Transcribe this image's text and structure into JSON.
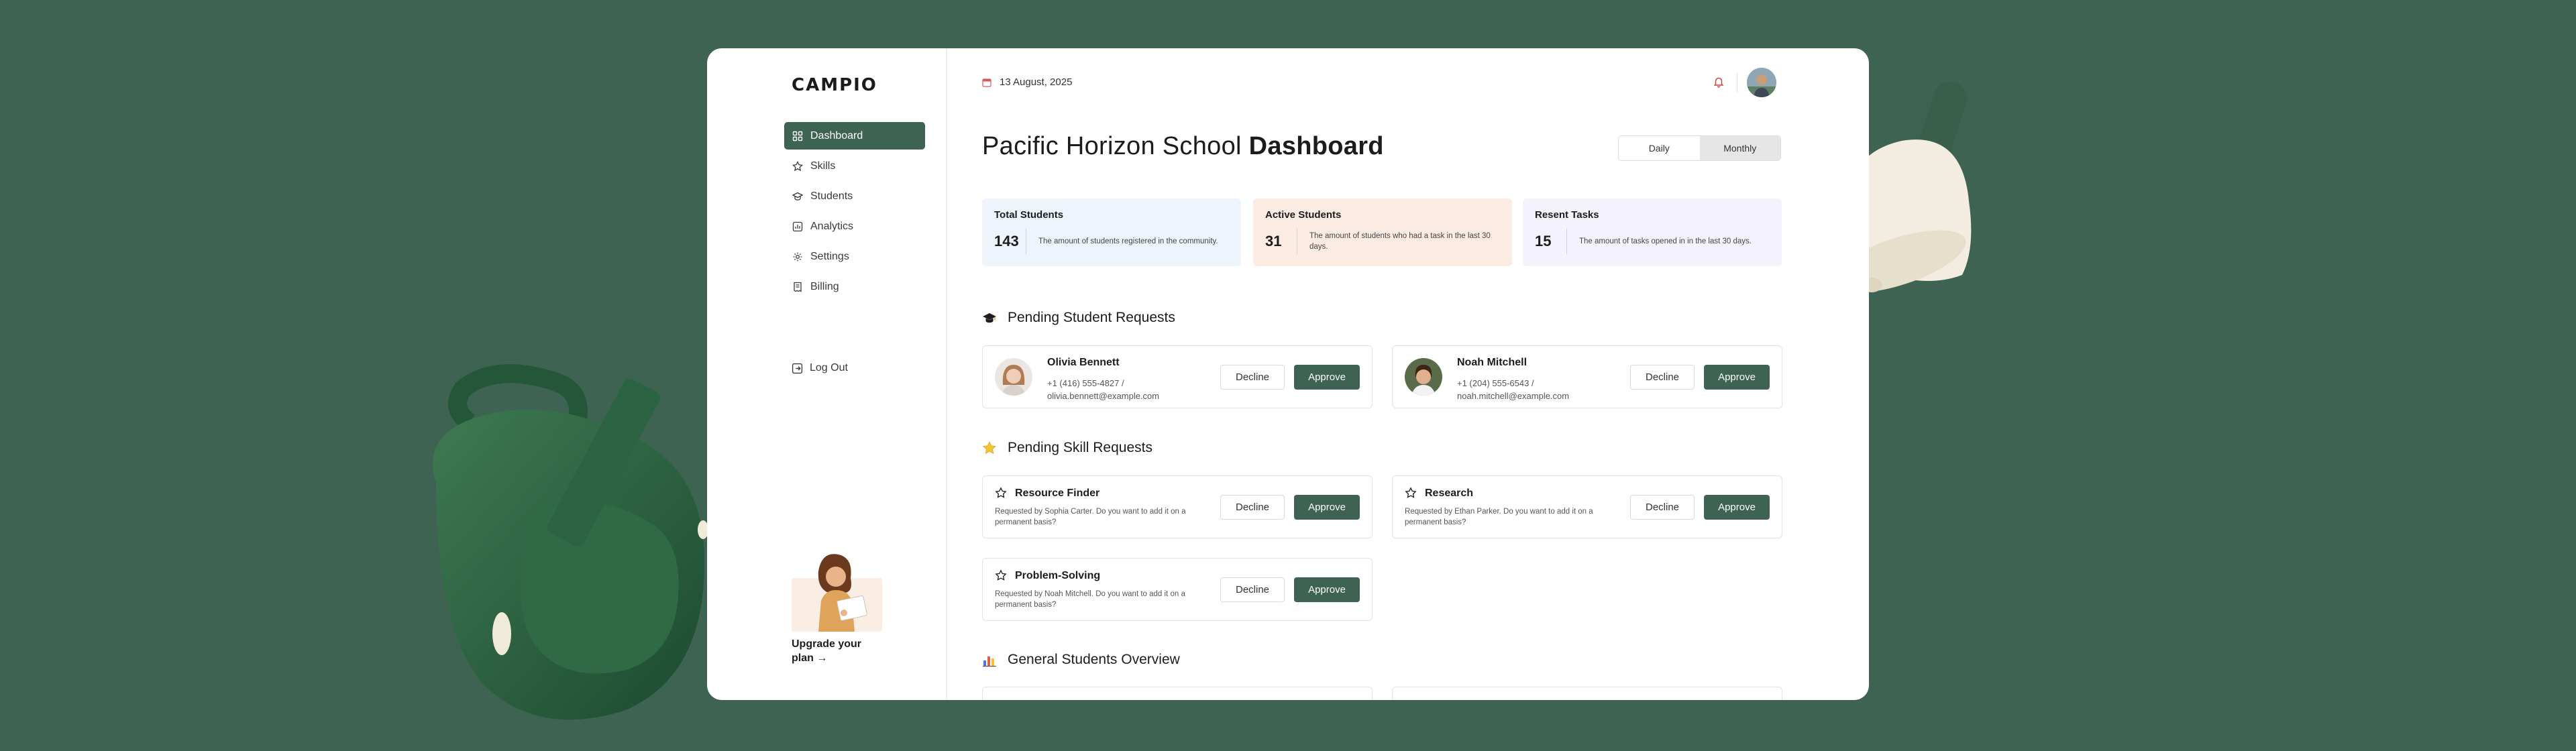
{
  "brand": {
    "logo": "CAMPIO"
  },
  "sidebar": {
    "items": [
      {
        "label": "Dashboard",
        "icon": "grid-icon",
        "active": true
      },
      {
        "label": "Skills",
        "icon": "star-icon",
        "active": false
      },
      {
        "label": "Students",
        "icon": "graduation-cap-icon",
        "active": false
      },
      {
        "label": "Analytics",
        "icon": "chart-icon",
        "active": false
      },
      {
        "label": "Settings",
        "icon": "gear-icon",
        "active": false
      },
      {
        "label": "Billing",
        "icon": "receipt-icon",
        "active": false
      }
    ],
    "logout_label": "Log Out",
    "upgrade_label": "Upgrade your plan",
    "upgrade_arrow": "→"
  },
  "header": {
    "date": "13 August, 2025"
  },
  "page": {
    "title_light": "Pacific Horizon School",
    "title_bold": "Dashboard"
  },
  "toggle": {
    "options": [
      "Daily",
      "Monthly"
    ],
    "selected": "Monthly"
  },
  "stats": [
    {
      "title": "Total Students",
      "value": "143",
      "desc": "The amount of students registered in the community.",
      "color": "#eef4fc"
    },
    {
      "title": "Active Students",
      "value": "31",
      "desc": "The amount of students who had a task in the last 30 days.",
      "color": "#fcebe3"
    },
    {
      "title": "Resent Tasks",
      "value": "15",
      "desc": "The amount of tasks opened in in the last 30 days.",
      "color": "#f4f2fc"
    }
  ],
  "student_requests": {
    "title": "Pending Student Requests",
    "items": [
      {
        "name": "Olivia Bennett",
        "phone": "+1 (416) 555-4827  /",
        "email": "olivia.bennett@example.com"
      },
      {
        "name": "Noah Mitchell",
        "phone": "+1 (204) 555-6543  /",
        "email": "noah.mitchell@example.com"
      }
    ]
  },
  "skill_requests": {
    "title": "Pending Skill Requests",
    "items": [
      {
        "name": "Resource Finder",
        "desc": "Requested by Sophia Carter. Do you want to add it on a permanent basis?"
      },
      {
        "name": "Research",
        "desc": "Requested by Ethan Parker. Do you want to add it on a permanent basis?"
      },
      {
        "name": "Problem-Solving",
        "desc": "Requested by Noah Mitchell. Do you want to add it on a permanent basis?"
      }
    ]
  },
  "overview": {
    "title": "General Students Overview"
  },
  "actions": {
    "decline": "Decline",
    "approve": "Approve"
  },
  "colors": {
    "accent": "#3f6352",
    "background": "#3f6352"
  }
}
